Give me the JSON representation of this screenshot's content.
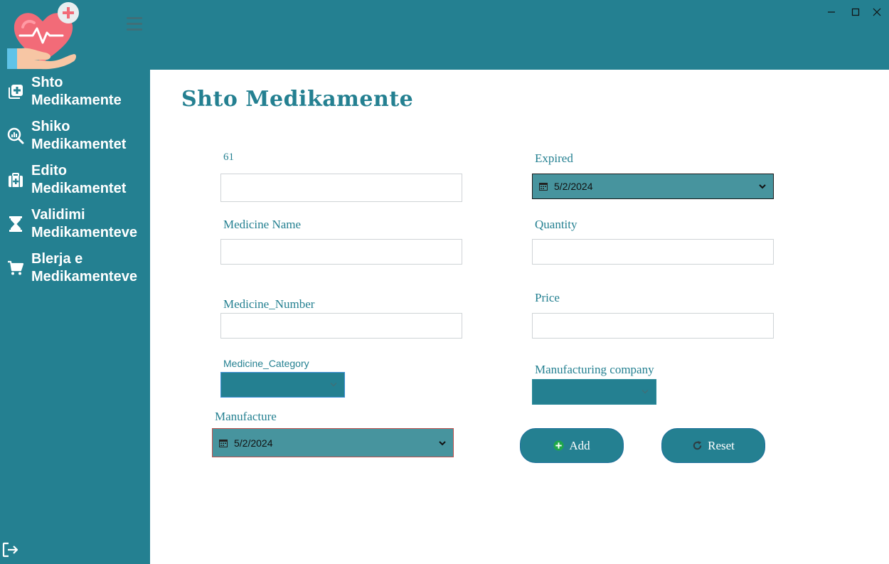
{
  "window": {
    "controls": {
      "minimize": "–",
      "maximize": "□",
      "close": "✕"
    }
  },
  "sidebar": {
    "items": [
      {
        "label": "Shto Medikamente",
        "icon": "add-box-icon"
      },
      {
        "label": "Shiko Medikamentet",
        "icon": "analytics-search-icon"
      },
      {
        "label": "Edito Medikamentet",
        "icon": "medical-bag-icon"
      },
      {
        "label": "Validimi Medikamenteve",
        "icon": "hourglass-icon"
      },
      {
        "label": "Blerja e Medikamenteve",
        "icon": "cart-icon"
      }
    ],
    "logout_icon": "logout-icon"
  },
  "page": {
    "title": "Shto Medikamente"
  },
  "form": {
    "id_label": "61",
    "id_value": "",
    "medicine_name_label": "Medicine Name",
    "medicine_name_value": "",
    "medicine_number_label": "Medicine_Number",
    "medicine_number_value": "",
    "medicine_category_label": "Medicine_Category",
    "medicine_category_value": "",
    "manufacture_label": "Manufacture",
    "manufacture_value": "5/2/2024",
    "expired_label": "Expired",
    "expired_value": "5/2/2024",
    "quantity_label": "Quantity",
    "quantity_value": "",
    "price_label": "Price",
    "price_value": "",
    "manufacturing_company_label": "Manufacturing company",
    "manufacturing_company_value": "",
    "add_label": "Add",
    "reset_label": "Reset"
  },
  "colors": {
    "primary": "#248091",
    "date_field": "#47949e",
    "white": "#ffffff",
    "add_icon": "#1fa84a"
  }
}
